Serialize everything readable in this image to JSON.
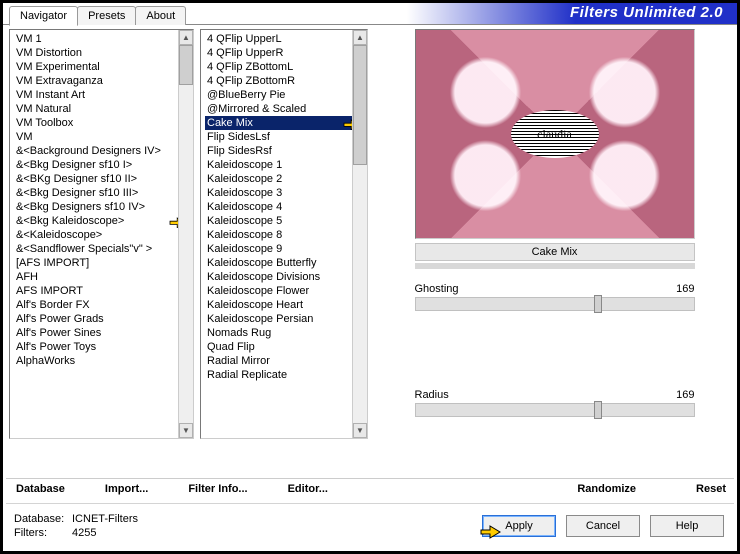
{
  "app_title": "Filters Unlimited 2.0",
  "tabs": [
    "Navigator",
    "Presets",
    "About"
  ],
  "active_tab": 0,
  "categories": [
    "VM 1",
    "VM Distortion",
    "VM Experimental",
    "VM Extravaganza",
    "VM Instant Art",
    "VM Natural",
    "VM Toolbox",
    "VM",
    "&<Background Designers IV>",
    "&<Bkg Designer sf10 I>",
    "&<BKg Designer sf10 II>",
    "&<Bkg Designer sf10 III>",
    "&<Bkg Designers sf10 IV>",
    "&<Bkg Kaleidoscope>",
    "&<Kaleidoscope>",
    "&<Sandflower Specials\"v\" >",
    "[AFS IMPORT]",
    "AFH",
    "AFS IMPORT",
    "Alf's Border FX",
    "Alf's Power Grads",
    "Alf's Power Sines",
    "Alf's Power Toys",
    "AlphaWorks"
  ],
  "category_pointer_index": 13,
  "filters": [
    "4 QFlip UpperL",
    "4 QFlip UpperR",
    "4 QFlip ZBottomL",
    "4 QFlip ZBottomR",
    "@BlueBerry Pie",
    "@Mirrored & Scaled",
    "Cake Mix",
    "Flip SidesLsf",
    "Flip SidesRsf",
    "Kaleidoscope 1",
    "Kaleidoscope 2",
    "Kaleidoscope 3",
    "Kaleidoscope 4",
    "Kaleidoscope 5",
    "Kaleidoscope 8",
    "Kaleidoscope 9",
    "Kaleidoscope Butterfly",
    "Kaleidoscope Divisions",
    "Kaleidoscope Flower",
    "Kaleidoscope Heart",
    "Kaleidoscope Persian",
    "Nomads Rug",
    "Quad Flip",
    "Radial Mirror",
    "Radial Replicate"
  ],
  "filter_selected_index": 6,
  "selected_filter_name": "Cake Mix",
  "params": [
    {
      "label": "Ghosting",
      "value": 169,
      "pct": 66
    },
    {
      "label": "Radius",
      "value": 169,
      "pct": 66
    }
  ],
  "toolbar": {
    "database": "Database",
    "import": "Import...",
    "filter_info": "Filter Info...",
    "editor": "Editor...",
    "randomize": "Randomize",
    "reset": "Reset"
  },
  "buttons": {
    "apply": "Apply",
    "cancel": "Cancel",
    "help": "Help"
  },
  "status": {
    "db_label": "Database:",
    "db_value": "ICNET-Filters",
    "filters_label": "Filters:",
    "filters_value": "4255"
  },
  "watermark": "claudia"
}
